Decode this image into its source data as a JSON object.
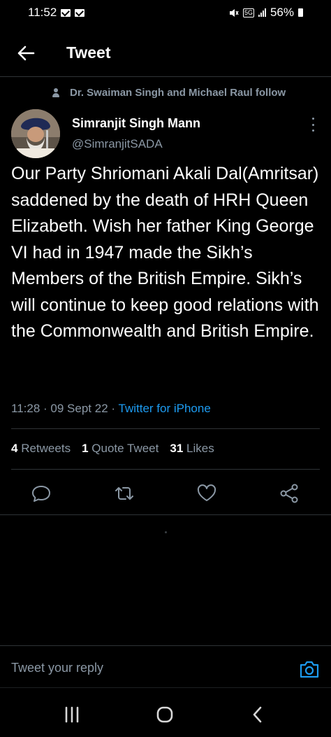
{
  "status_bar": {
    "time": "11:52",
    "network": "5G",
    "battery": "56%"
  },
  "header": {
    "title": "Tweet"
  },
  "social_context": "Dr. Swaiman Singh and Michael Raul follow",
  "tweet": {
    "author_name": "Simranjit Singh Mann",
    "author_handle": "@SimranjitSADA",
    "text": "Our Party Shriomani Akali Dal(Amritsar) saddened by the death of HRH Queen Elizabeth. Wish her father King George VI had in 1947 made the Sikh’s Members of the British Empire. Sikh’s will continue to keep good relations with the Commonwealth and British Empire.",
    "time": "11:28",
    "date": "09 Sept 22",
    "separator": "·",
    "client": "Twitter for iPhone",
    "retweets_count": "4",
    "retweets_label": "Retweets",
    "quotes_count": "1",
    "quotes_label": "Quote Tweet",
    "likes_count": "31",
    "likes_label": "Likes"
  },
  "reply": {
    "placeholder": "Tweet your reply"
  },
  "icons": [
    "back-arrow-icon",
    "person-icon",
    "more-icon",
    "reply-icon",
    "retweet-icon",
    "like-icon",
    "share-icon",
    "camera-icon",
    "recent-apps-icon",
    "home-icon",
    "back-icon"
  ],
  "colors": {
    "background": "#000000",
    "accent": "#1d9bf0",
    "secondary_text": "#8b98a5",
    "divider": "#2f3336"
  }
}
